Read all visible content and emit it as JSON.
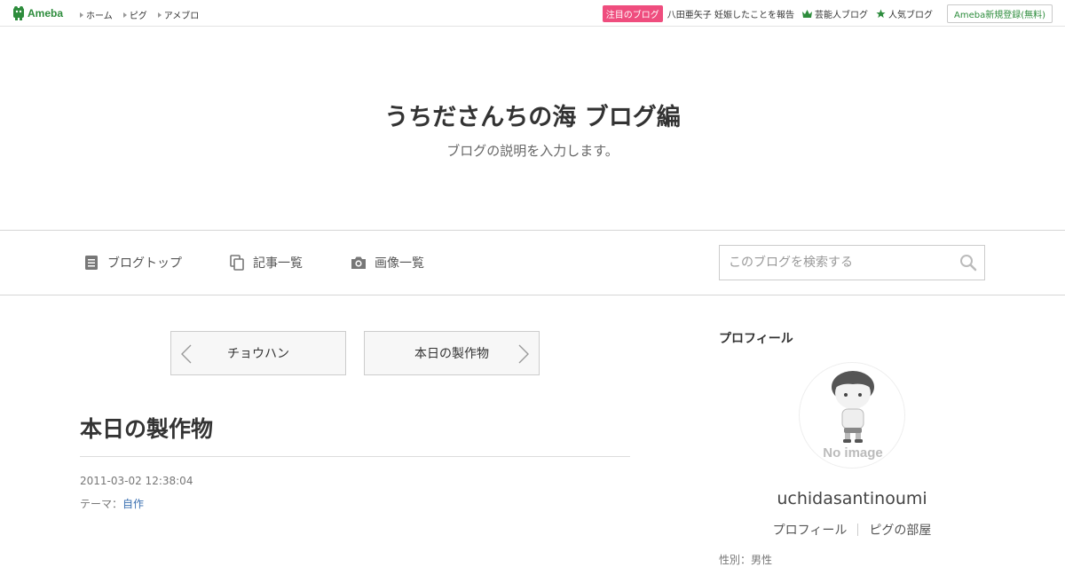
{
  "topbar": {
    "logo_text": "Ameba",
    "nav": [
      "ホーム",
      "ピグ",
      "アメブロ"
    ],
    "attention_badge": "注目のブログ",
    "attention_link": "八田亜矢子 妊娠したことを報告",
    "celebrity_blog": "芸能人ブログ",
    "popular_blog": "人気ブログ",
    "register": "Ameba新規登録(無料)"
  },
  "header": {
    "title": "うちださんちの海 ブログ編",
    "description": "ブログの説明を入力します。"
  },
  "navbar": {
    "blog_top": "ブログトップ",
    "article_list": "記事一覧",
    "image_list": "画像一覧",
    "search_placeholder": "このブログを検索する"
  },
  "pager": {
    "prev": "チョウハン",
    "next": "本日の製作物"
  },
  "article": {
    "title": "本日の製作物",
    "date": "2011-03-02 12:38:04",
    "theme_label": "テーマ：",
    "theme_value": "自作"
  },
  "sidebar": {
    "heading": "プロフィール",
    "avatar_text": "No image",
    "username": "uchidasantinoumi",
    "profile_link": "プロフィール",
    "pig_room_link": "ピグの部屋",
    "extra": "性別：男性"
  },
  "colors": {
    "brand_green": "#2d8c3c",
    "attention_pink": "#ef4d7e",
    "link_blue": "#3a6fb0"
  }
}
